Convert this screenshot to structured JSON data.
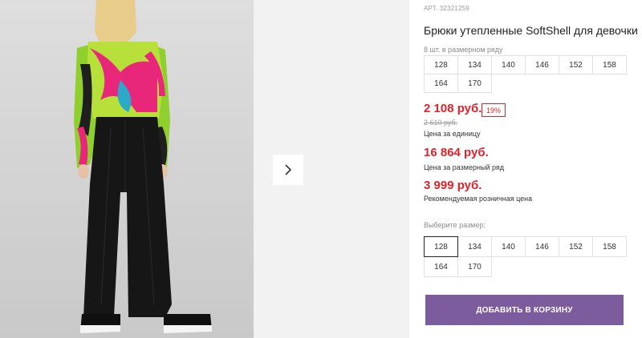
{
  "product": {
    "sku": "АРТ. 32321259",
    "title": "Брюки утепленные SoftShell для девочки"
  },
  "size_row": {
    "note": "8 шт. в размерном ряду",
    "sizes": [
      "128",
      "134",
      "140",
      "146",
      "152",
      "158",
      "164",
      "170"
    ]
  },
  "pricing": {
    "unit_price": "2 108 руб.",
    "discount_badge": "19%",
    "old_price": "2 610 руб.",
    "unit_label": "Цена за единицу",
    "set_price": "16 864 руб.",
    "set_label": "Цена за размерный ряд",
    "rrp_price": "3 999 руб.",
    "rrp_label": "Рекомендуемая розничная цена"
  },
  "size_select": {
    "label": "Выберите размер:",
    "selected": "128",
    "sizes": [
      "128",
      "134",
      "140",
      "146",
      "152",
      "158",
      "164",
      "170"
    ]
  },
  "cart": {
    "label": "ДОБАВИТЬ В КОРЗИНУ",
    "color": "#7d5c9e"
  },
  "gallery": {
    "next_icon": "chevron-right-icon"
  },
  "colors": {
    "price_red": "#e0222b",
    "gallery_bg": "#f2f2f2"
  }
}
